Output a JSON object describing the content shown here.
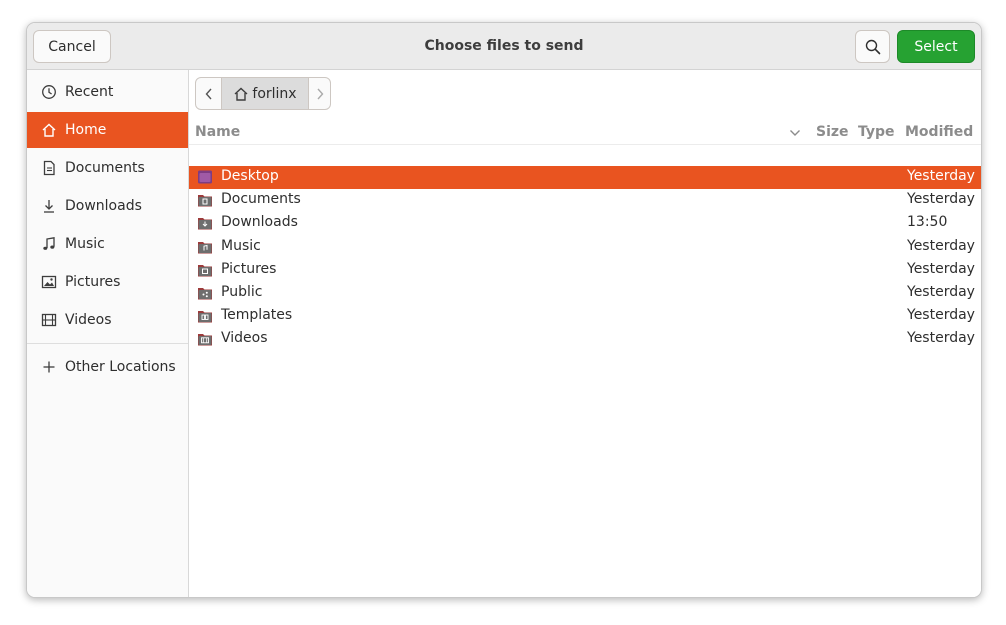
{
  "header": {
    "cancel_label": "Cancel",
    "title": "Choose files to send",
    "select_label": "Select"
  },
  "sidebar": {
    "items": [
      {
        "label": "Recent",
        "icon": "clock-icon"
      },
      {
        "label": "Home",
        "icon": "home-icon",
        "active": true
      },
      {
        "label": "Documents",
        "icon": "document-icon"
      },
      {
        "label": "Downloads",
        "icon": "download-icon"
      },
      {
        "label": "Music",
        "icon": "music-note-icon"
      },
      {
        "label": "Pictures",
        "icon": "picture-icon"
      },
      {
        "label": "Videos",
        "icon": "film-icon"
      }
    ],
    "other_locations": {
      "label": "Other Locations",
      "icon": "plus-icon"
    }
  },
  "pathbar": {
    "current": "forlinx"
  },
  "columns": {
    "name": "Name",
    "size": "Size",
    "type": "Type",
    "modified": "Modified"
  },
  "files": [
    {
      "name": "Desktop",
      "modified": "Yesterday",
      "selected": true
    },
    {
      "name": "Documents",
      "modified": "Yesterday"
    },
    {
      "name": "Downloads",
      "modified": "13:50"
    },
    {
      "name": "Music",
      "modified": "Yesterday"
    },
    {
      "name": "Pictures",
      "modified": "Yesterday"
    },
    {
      "name": "Public",
      "modified": "Yesterday"
    },
    {
      "name": "Templates",
      "modified": "Yesterday"
    },
    {
      "name": "Videos",
      "modified": "Yesterday"
    }
  ],
  "colors": {
    "accent": "#e95420",
    "select_button": "#26a232"
  }
}
